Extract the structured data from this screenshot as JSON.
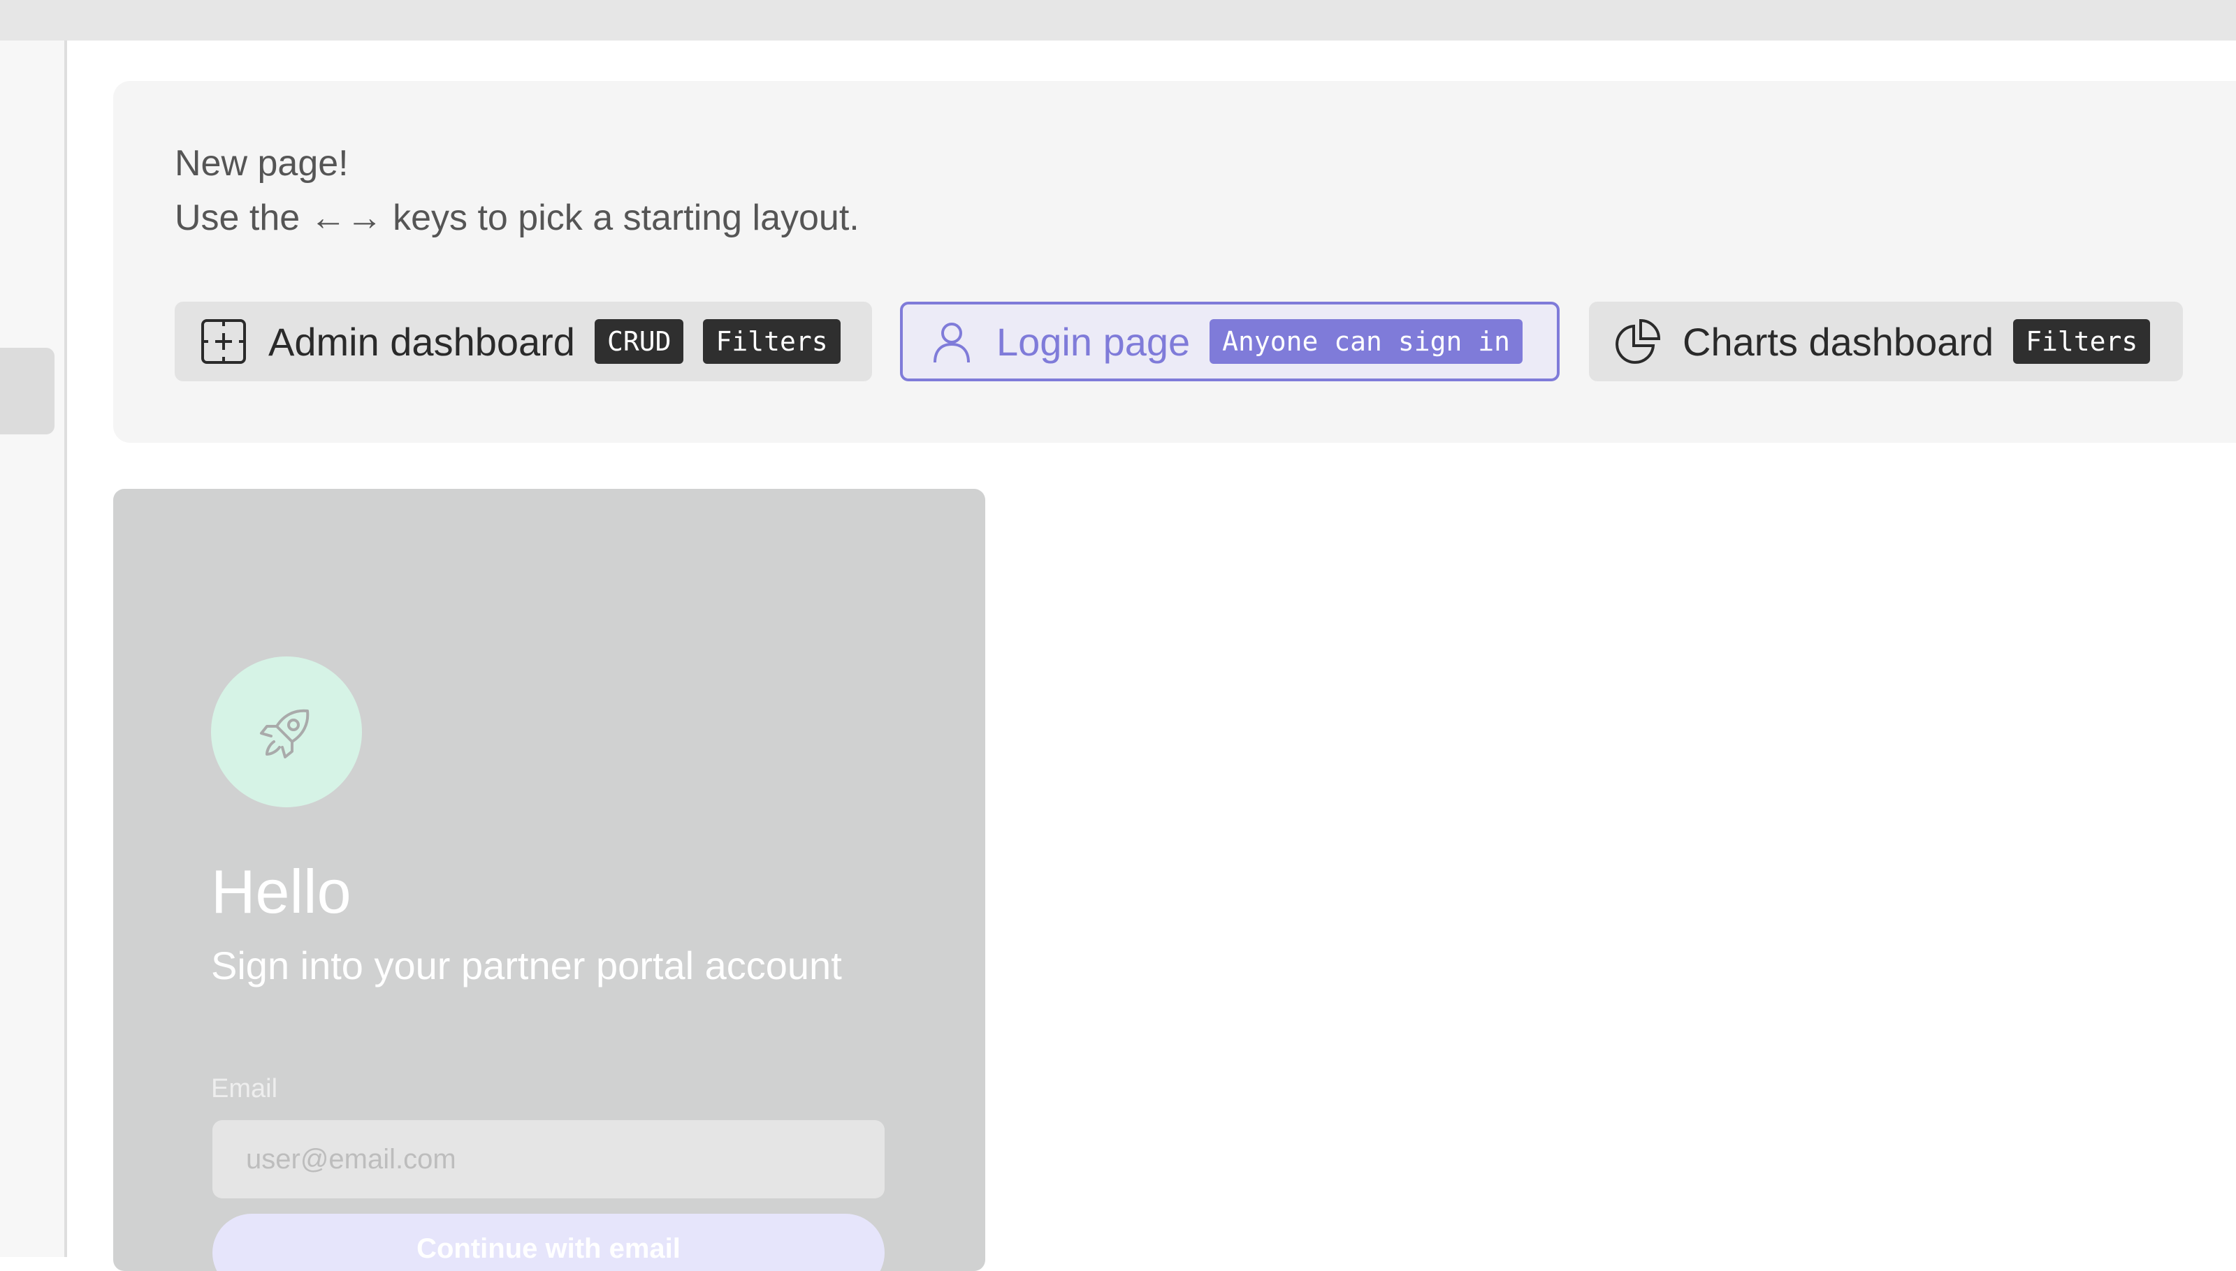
{
  "sidebar": {
    "truncated_label": "..",
    "selected_item": ""
  },
  "chooser": {
    "line1": "New page!",
    "line2": "Use the ←→ keys to pick a starting layout.",
    "options": [
      {
        "label": "Admin dashboard",
        "icon": "plus-frame-icon",
        "tags": [
          "CRUD",
          "Filters"
        ],
        "selected": false
      },
      {
        "label": "Login page",
        "icon": "user-icon",
        "tags": [
          "Anyone can sign in"
        ],
        "selected": true
      },
      {
        "label": "Charts dashboard",
        "icon": "pie-chart-icon",
        "tags": [
          "Filters"
        ],
        "selected": false
      }
    ]
  },
  "preview": {
    "icon": "rocket-icon",
    "title": "Hello",
    "subtitle": "Sign into your partner portal account",
    "email_label": "Email",
    "email_placeholder": "user@email.com",
    "email_value": "",
    "continue_label": "Continue with email"
  },
  "colors": {
    "accent": "#7f7bd9",
    "tag_dark": "#2f2f2f",
    "rocket_circle": "#d6f3e6",
    "preview_bg": "#d0d1d1"
  }
}
